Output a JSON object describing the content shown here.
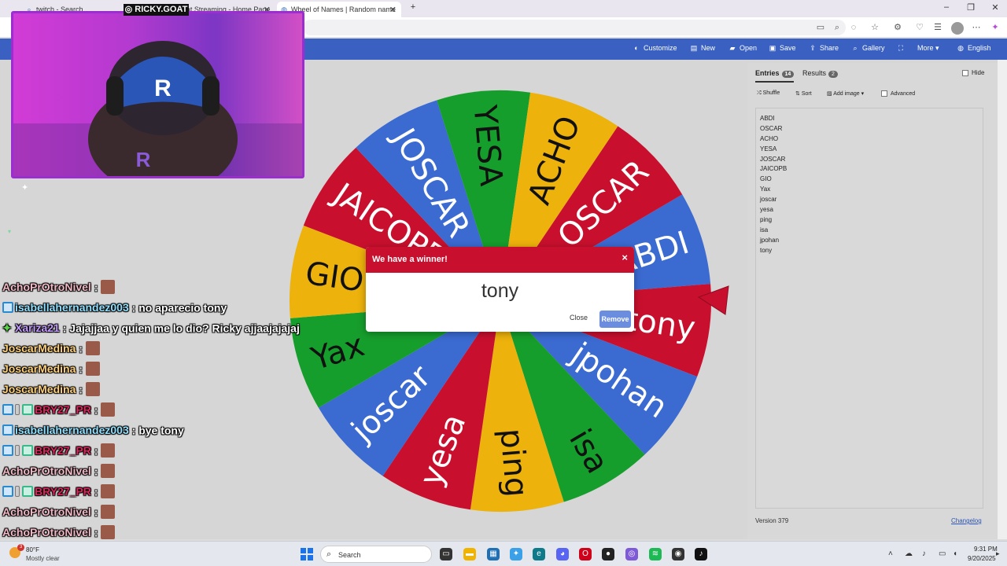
{
  "browser": {
    "tabs": [
      {
        "label": "twitch - Search",
        "active": false
      },
      {
        "label": "Ricky.goat Streaming - Home Page",
        "active": false
      },
      {
        "label": "Wheel of Names | Random name",
        "active": true
      }
    ],
    "new_tab": "+",
    "window_controls": {
      "minimize": "–",
      "maximize": "❐",
      "close": "✕"
    }
  },
  "navbar": {
    "items": [
      "Customize",
      "New",
      "Open",
      "Save",
      "Share",
      "Gallery",
      "More",
      "English"
    ],
    "icons": [
      "palette-icon",
      "file-icon",
      "folder-icon",
      "save-icon",
      "share-icon",
      "search-icon",
      "fullscreen-icon",
      "globe-icon"
    ]
  },
  "wheel": {
    "segments": [
      {
        "label": "ABDI",
        "color": "#3B6AD1"
      },
      {
        "label": "tony",
        "color": "#C8102E"
      },
      {
        "label": "jpohan",
        "color": "#3B6AD1"
      },
      {
        "label": "isa",
        "color": "#169E2C"
      },
      {
        "label": "ping",
        "color": "#EDB20C"
      },
      {
        "label": "yesa",
        "color": "#C8102E"
      },
      {
        "label": "joscar",
        "color": "#3B6AD1"
      },
      {
        "label": "Yax",
        "color": "#169E2C"
      },
      {
        "label": "GIO",
        "color": "#EDB20C"
      },
      {
        "label": "JAICOPB",
        "color": "#C8102E"
      },
      {
        "label": "JOSCAR",
        "color": "#3B6AD1"
      },
      {
        "label": "YESA",
        "color": "#169E2C"
      },
      {
        "label": "ACHO",
        "color": "#EDB20C"
      },
      {
        "label": "OSCAR",
        "color": "#C8102E"
      }
    ],
    "pointer_color": "#C8102E"
  },
  "panel": {
    "tabs": [
      {
        "label": "Entries",
        "count": "14"
      },
      {
        "label": "Results",
        "count": "2"
      }
    ],
    "hide_label": "Hide",
    "tools": {
      "shuffle": "Shuffle",
      "sort": "Sort",
      "add_image": "Add image",
      "advanced": "Advanced"
    },
    "entries": [
      "ABDI",
      "OSCAR",
      "ACHO",
      "YESA",
      "JOSCAR",
      "JAICOPB",
      "GIO",
      "Yax",
      "joscar",
      "yesa",
      "ping",
      "isa",
      "jpohan",
      "tony"
    ],
    "version": "Version 379",
    "changelog": "Changelog"
  },
  "modal": {
    "title": "We have a winner!",
    "close_x": "×",
    "winner": "tony",
    "close_button": "Close",
    "remove_button": "Remove"
  },
  "webcam": {
    "label": "◎ RICKY.GOAT"
  },
  "chat": [
    {
      "user": "AchoPrOtroNivel",
      "color": "#f2b8c6",
      "msg": "",
      "emote": true
    },
    {
      "user": "isabellahernandez003",
      "color": "#8fe0ff",
      "msg": "no aparecio tony",
      "emote": false,
      "badge": "blue"
    },
    {
      "user": "Xariza21",
      "color": "#c39bff",
      "msg": "Jajajjaa y quien me lo dio? Ricky ajjaajajajaj",
      "emote": false,
      "badge": "star"
    },
    {
      "user": "JoscarMedina",
      "color": "#ffd27a",
      "msg": "",
      "emote": true
    },
    {
      "user": "JoscarMedina",
      "color": "#ffd27a",
      "msg": "",
      "emote": true
    },
    {
      "user": "JoscarMedina",
      "color": "#ffd27a",
      "msg": "",
      "emote": true
    },
    {
      "user": "BRY27_PR",
      "color": "#e0245e",
      "msg": "",
      "emote": true,
      "badge": "multi"
    },
    {
      "user": "isabellahernandez003",
      "color": "#8fe0ff",
      "msg": "bye tony",
      "emote": false,
      "badge": "blue"
    },
    {
      "user": "BRY27_PR",
      "color": "#e0245e",
      "msg": "",
      "emote": true,
      "badge": "multi"
    },
    {
      "user": "AchoPrOtroNivel",
      "color": "#f2b8c6",
      "msg": "",
      "emote": true
    },
    {
      "user": "BRY27_PR",
      "color": "#e0245e",
      "msg": "",
      "emote": true,
      "badge": "multi"
    },
    {
      "user": "AchoPrOtroNivel",
      "color": "#f2b8c6",
      "msg": "",
      "emote": true
    },
    {
      "user": "AchoPrOtroNivel",
      "color": "#f2b8c6",
      "msg": "",
      "emote": true
    }
  ],
  "taskbar": {
    "weather_temp": "80°F",
    "weather_desc": "Mostly clear",
    "weather_badge": "3",
    "search": "Search",
    "time": "9:31 PM",
    "date": "9/20/2025"
  }
}
